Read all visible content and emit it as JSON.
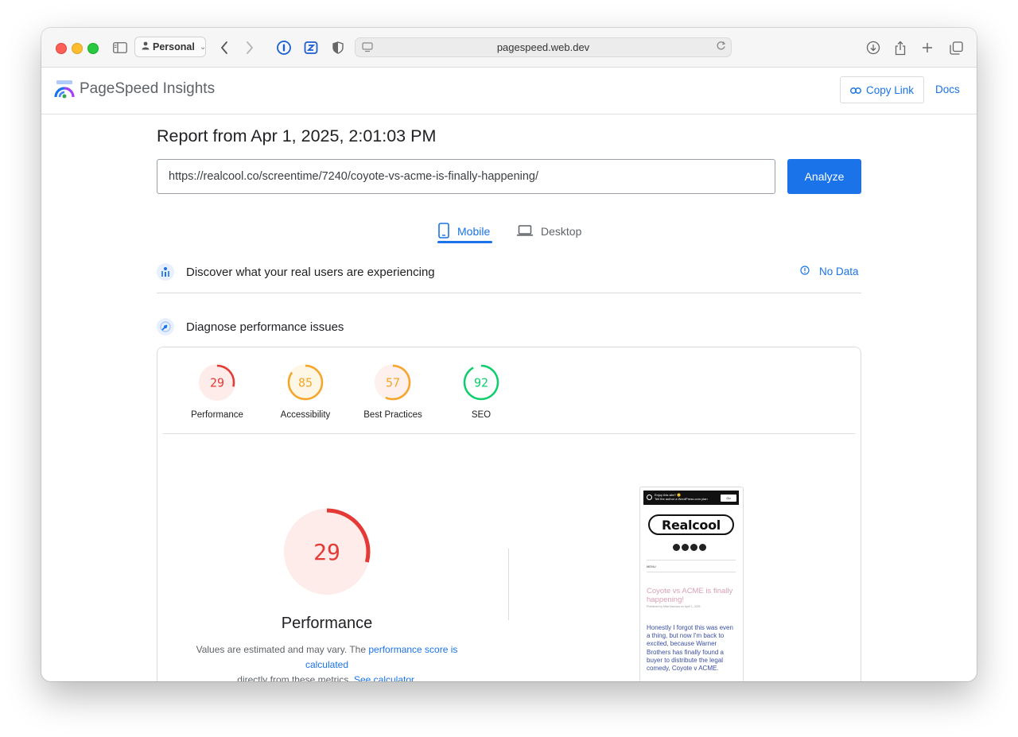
{
  "browser": {
    "profile": "Personal",
    "address": "pagespeed.web.dev"
  },
  "app": {
    "name": "PageSpeed Insights",
    "copy_link": "Copy Link",
    "docs": "Docs"
  },
  "report": {
    "title": "Report from Apr 1, 2025, 2:01:03 PM",
    "url": "https://realcool.co/screentime/7240/coyote-vs-acme-is-finally-happening/",
    "analyze": "Analyze"
  },
  "tabs": {
    "mobile": "Mobile",
    "desktop": "Desktop",
    "active": "Mobile"
  },
  "real_users": {
    "title": "Discover what your real users are experiencing",
    "status": "No Data"
  },
  "diagnose": {
    "title": "Diagnose performance issues"
  },
  "scores": [
    {
      "label": "Performance",
      "value": 29,
      "color": "#e53935",
      "bg": "#fdecea"
    },
    {
      "label": "Accessibility",
      "value": 85,
      "color": "#f4a62a",
      "bg": "#fef7e6"
    },
    {
      "label": "Best Practices",
      "value": 57,
      "color": "#f4a62a",
      "bg": "#fef0ec"
    },
    {
      "label": "SEO",
      "value": 92,
      "color": "#0cce6b",
      "bg": "#ffffff"
    }
  ],
  "performance": {
    "score": 29,
    "title": "Performance",
    "desc_prefix": "Values are estimated and may vary. The ",
    "desc_link1": "performance score is calculated",
    "desc_middle": "directly from these metrics. ",
    "desc_link2": "See calculator."
  },
  "preview": {
    "bar_text_1": "Enjoy this site? 🙂",
    "bar_text_2": "Tell the author a WordPress.com plan",
    "bar_button": "Go",
    "logo": "Realcool",
    "menu": "MENU",
    "headline": "Coyote vs ACME is finally happening!",
    "byline": "Published by Mike Barrows on April 1, 2025",
    "body": "Honestly I forgot this was even a thing, but now I'm back to excited, because Warner Brothers has finally found a buyer to distribute the legal comedy, Coyote v ACME."
  }
}
